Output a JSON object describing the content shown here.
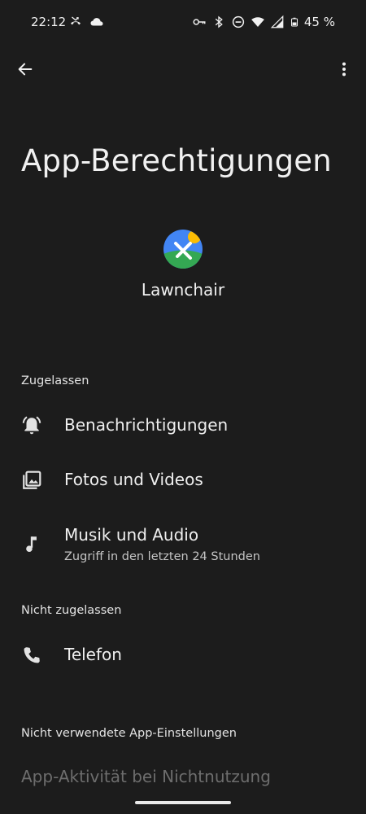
{
  "status_bar": {
    "time": "22:12",
    "battery_text": "45 %",
    "left_icons": [
      "missed-call-icon",
      "cloud-icon"
    ],
    "right_icons": [
      "vpn-key-icon",
      "bluetooth-icon",
      "do-not-disturb-icon",
      "wifi-icon",
      "signal-icon",
      "battery-icon"
    ]
  },
  "app_bar": {
    "back_icon": "arrow-back-icon",
    "more_icon": "more-vert-icon"
  },
  "page": {
    "title": "App-Berechtigungen"
  },
  "app": {
    "name": "Lawnchair",
    "icon_colors": {
      "sky": "#4285f4",
      "grass": "#34a853",
      "sun": "#fbbc04",
      "mark": "#ffffff"
    }
  },
  "sections": {
    "allowed": {
      "header": "Zugelassen",
      "items": [
        {
          "label": "Benachrichtigungen",
          "icon": "notifications-icon"
        },
        {
          "label": "Fotos und Videos",
          "icon": "photo-library-icon"
        },
        {
          "label": "Musik und Audio",
          "subtitle": "Zugriff in den letzten 24 Stunden",
          "icon": "music-note-icon"
        }
      ]
    },
    "not_allowed": {
      "header": "Nicht zugelassen",
      "items": [
        {
          "label": "Telefon",
          "icon": "phone-icon"
        }
      ]
    },
    "unused": {
      "header": "Nicht verwendete App-Einstellungen",
      "items": [
        {
          "label": "App-Aktivität bei Nichtnutzung"
        }
      ]
    }
  },
  "theme": {
    "background": "#1c1c1c",
    "text_primary": "#efefef",
    "text_secondary": "#c4c4c4",
    "text_disabled": "#6d6d6d"
  }
}
